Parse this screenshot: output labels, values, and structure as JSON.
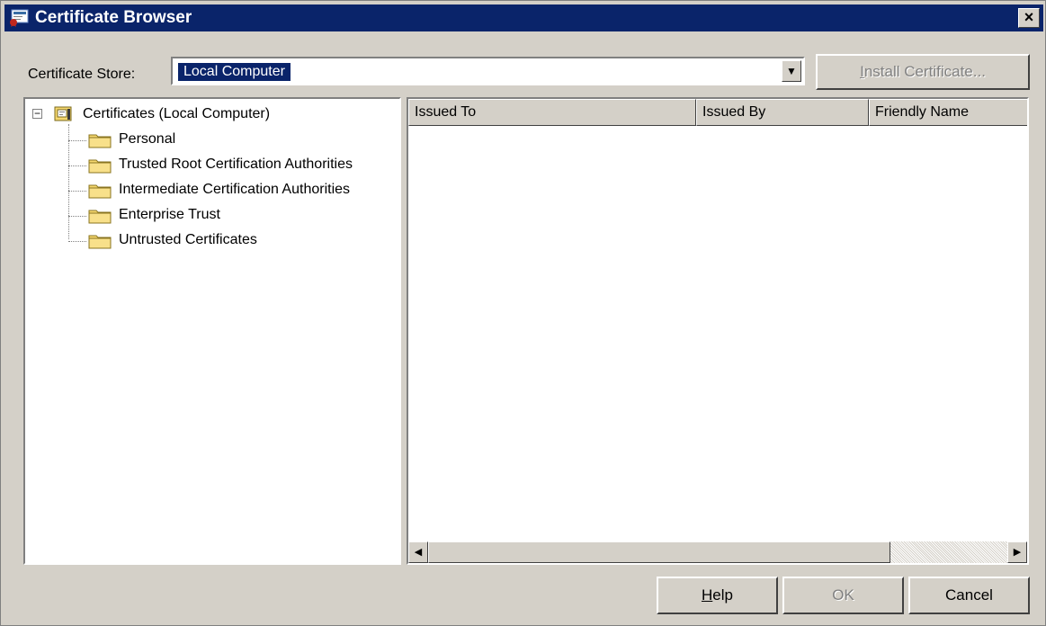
{
  "window": {
    "title": "Certificate Browser",
    "close_glyph": "×"
  },
  "store": {
    "label": "Certificate Store:",
    "selected": "Local Computer"
  },
  "buttons": {
    "install_prefix": "I",
    "install_rest": "nstall Certificate...",
    "install_enabled": false,
    "help_prefix": "H",
    "help_rest": "elp",
    "ok": "OK",
    "ok_enabled": false,
    "cancel": "Cancel"
  },
  "tree": {
    "root_label": "Certificates (Local Computer)",
    "root_icon": "certificate-store-icon",
    "expanded": true,
    "items": [
      {
        "label": "Personal",
        "icon": "folder-icon"
      },
      {
        "label": "Trusted Root Certification Authorities",
        "icon": "folder-icon"
      },
      {
        "label": "Intermediate Certification Authorities",
        "icon": "folder-icon"
      },
      {
        "label": "Enterprise Trust",
        "icon": "folder-icon"
      },
      {
        "label": "Untrusted Certificates",
        "icon": "folder-icon"
      }
    ]
  },
  "list": {
    "columns": [
      "Issued To",
      "Issued By",
      "Friendly Name"
    ],
    "rows": []
  },
  "colors": {
    "titlebar": "#0a246a",
    "face": "#d4d0c8",
    "folder": "#f5d76e"
  }
}
